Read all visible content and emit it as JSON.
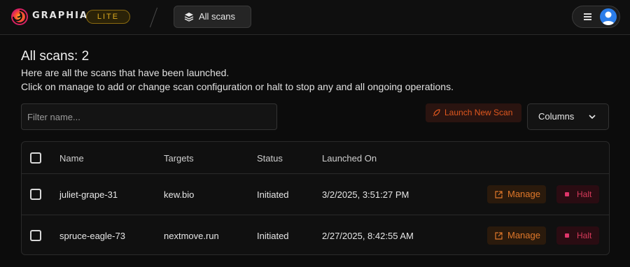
{
  "header": {
    "brand": "GRAPHIA",
    "badge": "LITE",
    "nav_button": "All scans",
    "icons": {
      "logo": "graphia-logo-icon",
      "nav": "layers-icon",
      "menu": "hamburger-menu-icon",
      "avatar": "user-avatar-icon"
    },
    "colors": {
      "badge": "#d9a820",
      "avatar": "#2b7de9"
    }
  },
  "main": {
    "title": "All scans: 2",
    "description_line1": "Here are all the scans that have been launched.",
    "description_line2": "Click on manage to add or change scan configuration or halt to stop any and all ongoing operations.",
    "filter": {
      "placeholder": "Filter name...",
      "value": ""
    },
    "launch_button": "Launch New Scan",
    "columns_button": "Columns",
    "colors": {
      "launch": "#e0581f",
      "manage": "#e0782a",
      "halt": "#d63a5a"
    }
  },
  "table": {
    "headers": {
      "name": "Name",
      "targets": "Targets",
      "status": "Status",
      "launched_on": "Launched On"
    },
    "rows": [
      {
        "name": "juliet-grape-31",
        "targets": "kew.bio",
        "status": "Initiated",
        "launched_on": "3/2/2025, 3:51:27 PM",
        "manage": "Manage",
        "halt": "Halt"
      },
      {
        "name": "spruce-eagle-73",
        "targets": "nextmove.run",
        "status": "Initiated",
        "launched_on": "2/27/2025, 8:42:55 AM",
        "manage": "Manage",
        "halt": "Halt"
      }
    ]
  }
}
